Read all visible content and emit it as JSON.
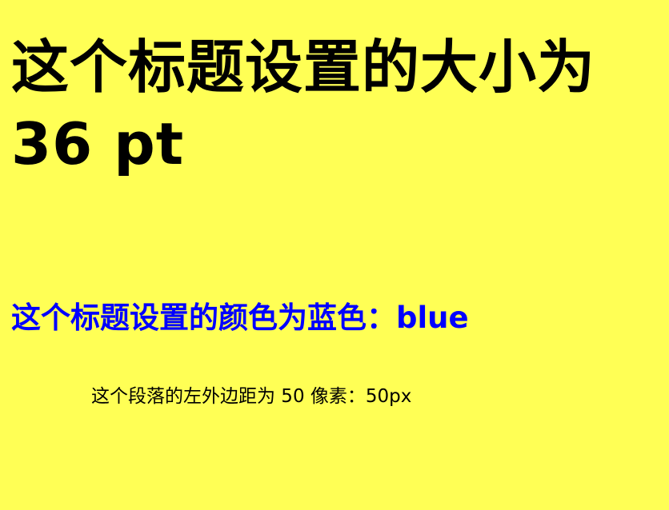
{
  "heading_large": "这个标题设置的大小为 36 pt",
  "heading_blue": "这个标题设置的颜色为蓝色：blue",
  "paragraph": "这个段落的左外边距为 50 像素：50px",
  "colors": {
    "background": "#ffff55",
    "heading_blue": "#0000ff",
    "text": "#000000"
  }
}
